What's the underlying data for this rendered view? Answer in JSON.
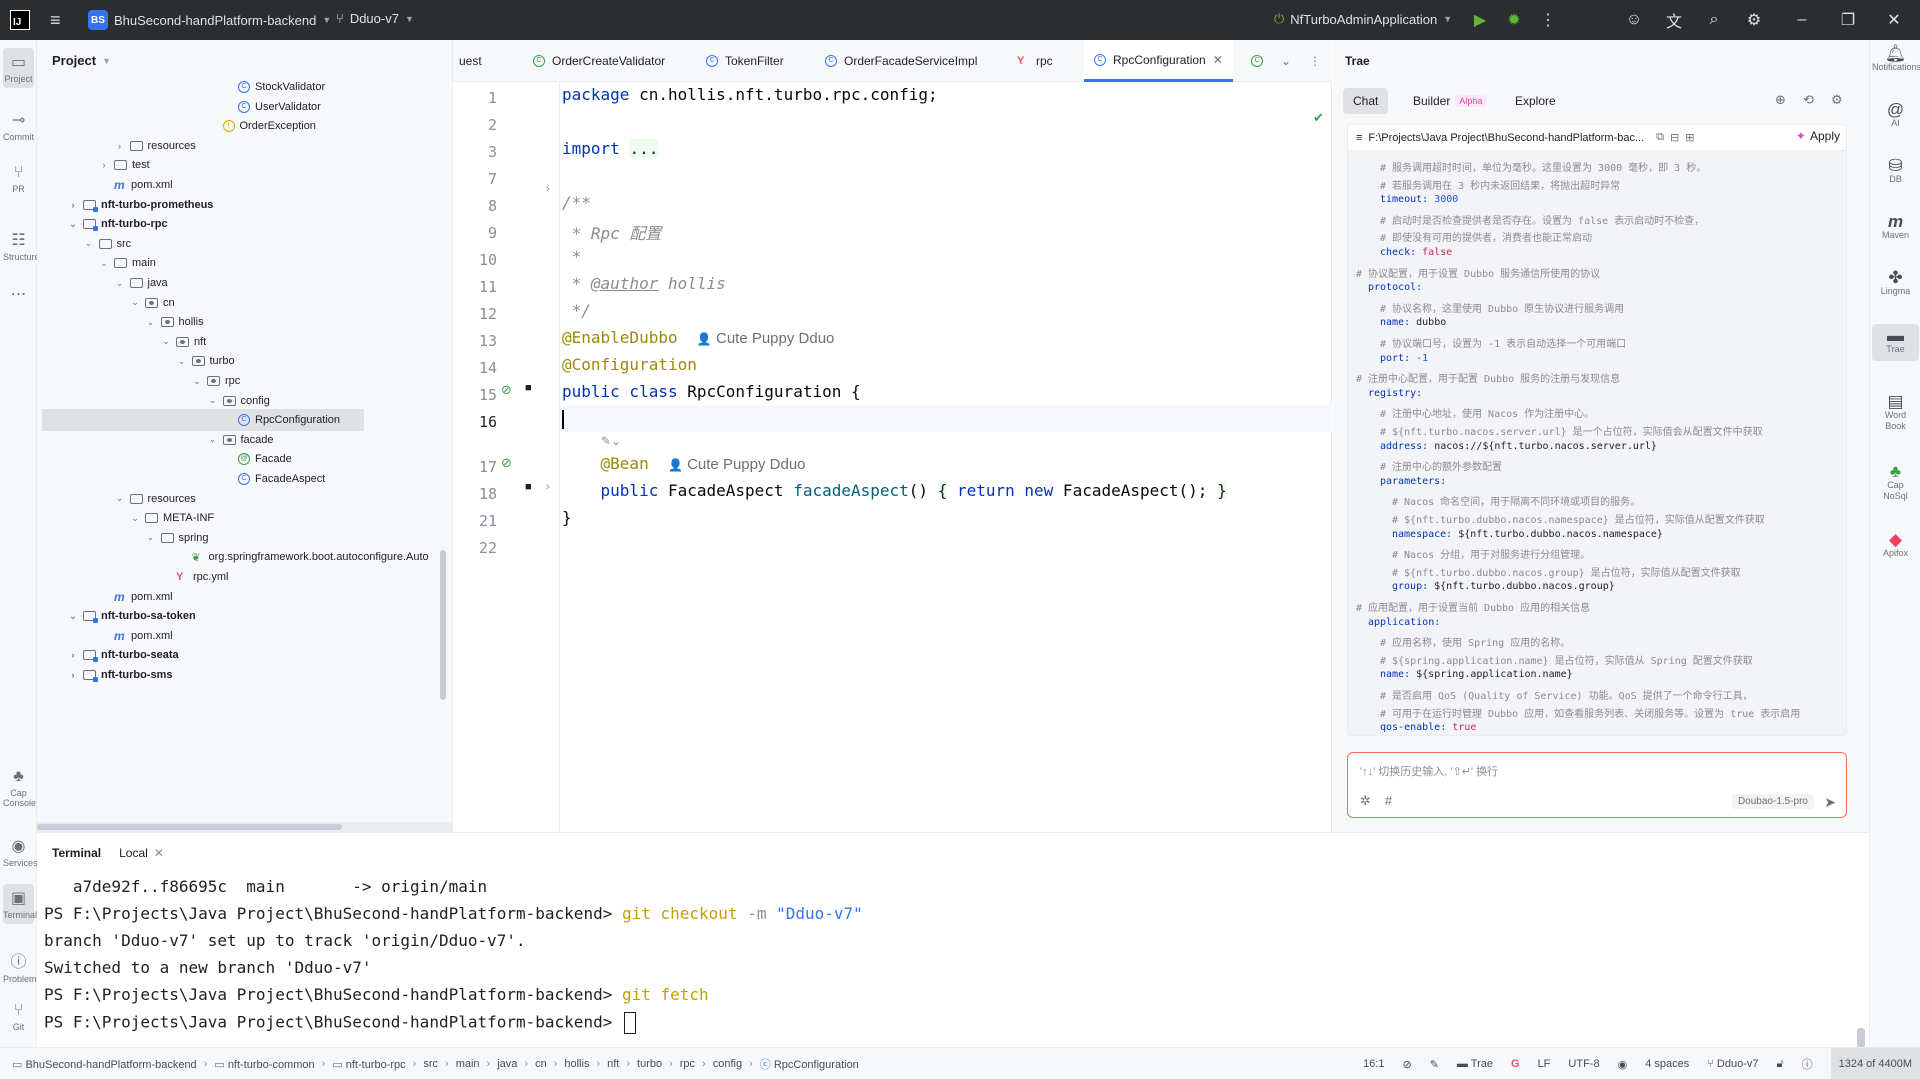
{
  "titlebar": {
    "project_badge": "BS",
    "project_name": "BhuSecond-handPlatform-backend",
    "branch": "Dduo-v7",
    "run_config": "NfTurboAdminApplication"
  },
  "left_strip": [
    {
      "label": "Project",
      "icon": "folder-icon"
    },
    {
      "label": "Commit",
      "icon": "commit-icon"
    },
    {
      "label": "PR",
      "icon": "pull-request-icon"
    },
    {
      "label": "Structure",
      "icon": "structure-icon"
    },
    {
      "label": "Cap Console",
      "icon": "cap-icon"
    },
    {
      "label": "Services",
      "icon": "services-icon"
    },
    {
      "label": "Terminal",
      "icon": "terminal-icon"
    },
    {
      "label": "Problems",
      "icon": "problems-icon"
    },
    {
      "label": "Git",
      "icon": "git-icon"
    }
  ],
  "project_panel": {
    "title": "Project",
    "rows": [
      {
        "label": "StockValidator",
        "icon": "class",
        "indent": 12,
        "arrow": "",
        "bold": false
      },
      {
        "label": "UserValidator",
        "icon": "class",
        "indent": 12,
        "arrow": "",
        "bold": false
      },
      {
        "label": "OrderException",
        "icon": "exception",
        "indent": 11,
        "arrow": "",
        "bold": false
      },
      {
        "label": "resources",
        "icon": "folder",
        "indent": 5,
        "arrow": ">",
        "bold": false
      },
      {
        "label": "test",
        "icon": "folder",
        "indent": 4,
        "arrow": ">",
        "bold": false
      },
      {
        "label": "pom.xml",
        "icon": "maven",
        "indent": 4,
        "arrow": "",
        "bold": false
      },
      {
        "label": "nft-turbo-prometheus",
        "icon": "module",
        "indent": 2,
        "arrow": ">",
        "bold": true
      },
      {
        "label": "nft-turbo-rpc",
        "icon": "module",
        "indent": 2,
        "arrow": "v",
        "bold": true
      },
      {
        "label": "src",
        "icon": "folder",
        "indent": 3,
        "arrow": "v",
        "bold": false
      },
      {
        "label": "main",
        "icon": "folder",
        "indent": 4,
        "arrow": "v",
        "bold": false
      },
      {
        "label": "java",
        "icon": "folder",
        "indent": 5,
        "arrow": "v",
        "bold": false
      },
      {
        "label": "cn",
        "icon": "package",
        "indent": 6,
        "arrow": "v",
        "bold": false
      },
      {
        "label": "hollis",
        "icon": "package",
        "indent": 7,
        "arrow": "v",
        "bold": false
      },
      {
        "label": "nft",
        "icon": "package",
        "indent": 8,
        "arrow": "v",
        "bold": false
      },
      {
        "label": "turbo",
        "icon": "package",
        "indent": 9,
        "arrow": "v",
        "bold": false
      },
      {
        "label": "rpc",
        "icon": "package",
        "indent": 10,
        "arrow": "v",
        "bold": false
      },
      {
        "label": "config",
        "icon": "package",
        "indent": 11,
        "arrow": "v",
        "bold": false
      },
      {
        "label": "RpcConfiguration",
        "icon": "class",
        "indent": 12,
        "arrow": "",
        "bold": false,
        "selected": true
      },
      {
        "label": "facade",
        "icon": "package",
        "indent": 11,
        "arrow": "v",
        "bold": false
      },
      {
        "label": "Facade",
        "icon": "annotation",
        "indent": 12,
        "arrow": "",
        "bold": false
      },
      {
        "label": "FacadeAspect",
        "icon": "class",
        "indent": 12,
        "arrow": "",
        "bold": false
      },
      {
        "label": "resources",
        "icon": "folder",
        "indent": 5,
        "arrow": "v",
        "bold": false
      },
      {
        "label": "META-INF",
        "icon": "folder",
        "indent": 6,
        "arrow": "v",
        "bold": false
      },
      {
        "label": "spring",
        "icon": "folder",
        "indent": 7,
        "arrow": "v",
        "bold": false
      },
      {
        "label": "org.springframework.boot.autoconfigure.Auto",
        "icon": "spring",
        "indent": 9,
        "arrow": "",
        "bold": false
      },
      {
        "label": "rpc.yml",
        "icon": "yml",
        "indent": 8,
        "arrow": "",
        "bold": false
      },
      {
        "label": "pom.xml",
        "icon": "maven",
        "indent": 4,
        "arrow": "",
        "bold": false
      },
      {
        "label": "nft-turbo-sa-token",
        "icon": "module",
        "indent": 2,
        "arrow": "v",
        "bold": true
      },
      {
        "label": "pom.xml",
        "icon": "maven",
        "indent": 4,
        "arrow": "",
        "bold": false
      },
      {
        "label": "nft-turbo-seata",
        "icon": "module",
        "indent": 2,
        "arrow": ">",
        "bold": true
      },
      {
        "label": "nft-turbo-sms",
        "icon": "module",
        "indent": 2,
        "arrow": ">",
        "bold": true
      }
    ]
  },
  "editor": {
    "tabs": [
      {
        "label": "uest",
        "icon": ""
      },
      {
        "label": "OrderCreateValidator",
        "icon": "green-class-icon"
      },
      {
        "label": "TokenFilter",
        "icon": "class-icon"
      },
      {
        "label": "OrderFacadeServiceImpl",
        "icon": "class-icon"
      },
      {
        "label": "rpc",
        "icon": "yml-icon"
      },
      {
        "label": "RpcConfiguration",
        "icon": "class-icon",
        "active": true
      }
    ],
    "line_numbers": [
      "1",
      "2",
      "3",
      "7",
      "8",
      "9",
      "10",
      "11",
      "12",
      "13",
      "14",
      "15",
      "16",
      "",
      "17",
      "18",
      "21",
      "22"
    ],
    "author_hint": "Cute Puppy Dduo",
    "lines": {
      "l1_kw": "package",
      "l1_rest": " cn.hollis.nft.turbo.rpc.config;",
      "l3_kw": "import",
      "l3_fold": "...",
      "l8": "/**",
      "l9": " * Rpc 配置",
      "l10": " *",
      "l11_star": " * ",
      "l11_tag": "@author",
      "l11_name": " hollis",
      "l12": " */",
      "l13": "@EnableDubbo",
      "l14": "@Configuration",
      "l15_kw": "public class",
      "l15_rest": " RpcConfiguration {",
      "l17": "@Bean",
      "l18_kw1": "public",
      "l18_type": " FacadeAspect ",
      "l18_fn": "facadeAspect",
      "l18_paren": "() ",
      "l18_ob": "{",
      "l18_ret": " return new",
      "l18_rest": " FacadeAspect(); ",
      "l18_cb": "}",
      "l21": "}"
    }
  },
  "trae": {
    "title": "Trae",
    "tabs": [
      "Chat",
      "Builder",
      "Explore"
    ],
    "builder_badge": "Alpha",
    "file_path": "F:\\Projects\\Java Project\\BhuSecond-handPlatform-bac...",
    "apply_label": "Apply",
    "yaml_lines": [
      {
        "t": "c",
        "i": 2,
        "text": "# 服务调用超时时间，单位为毫秒。这里设置为 3000 毫秒，即 3 秒。"
      },
      {
        "t": "c",
        "i": 2,
        "text": "# 若服务调用在 3 秒内未返回结果，将抛出超时异常"
      },
      {
        "t": "kv",
        "i": 2,
        "k": "timeout:",
        "v": " 3000",
        "vt": "num"
      },
      {
        "t": "c",
        "i": 2,
        "text": "# 启动时是否检查提供者是否存在。设置为 false 表示启动时不检查，"
      },
      {
        "t": "c",
        "i": 2,
        "text": "# 即使没有可用的提供者，消费者也能正常启动"
      },
      {
        "t": "kv",
        "i": 2,
        "k": "check:",
        "v": " false",
        "vt": "bool"
      },
      {
        "t": "c",
        "i": 0,
        "text": "# 协议配置，用于设置 Dubbo 服务通信所使用的协议"
      },
      {
        "t": "kv",
        "i": 1,
        "k": "protocol:",
        "v": "",
        "vt": ""
      },
      {
        "t": "c",
        "i": 2,
        "text": "# 协议名称，这里使用 Dubbo 原生协议进行服务调用"
      },
      {
        "t": "kv",
        "i": 2,
        "k": "name:",
        "v": " dubbo",
        "vt": "str"
      },
      {
        "t": "c",
        "i": 2,
        "text": "# 协议端口号，设置为 -1 表示自动选择一个可用端口"
      },
      {
        "t": "kv",
        "i": 2,
        "k": "port:",
        "v": " -1",
        "vt": "num"
      },
      {
        "t": "c",
        "i": 0,
        "text": "# 注册中心配置，用于配置 Dubbo 服务的注册与发现信息"
      },
      {
        "t": "kv",
        "i": 1,
        "k": "registry:",
        "v": "",
        "vt": ""
      },
      {
        "t": "c",
        "i": 2,
        "text": "# 注册中心地址，使用 Nacos 作为注册中心。"
      },
      {
        "t": "c",
        "i": 2,
        "text": "# ${nft.turbo.nacos.server.url} 是一个占位符，实际值会从配置文件中获取"
      },
      {
        "t": "kv",
        "i": 2,
        "k": "address:",
        "v": " nacos://${nft.turbo.nacos.server.url}",
        "vt": "str"
      },
      {
        "t": "c",
        "i": 2,
        "text": "# 注册中心的额外参数配置"
      },
      {
        "t": "kv",
        "i": 2,
        "k": "parameters:",
        "v": "",
        "vt": ""
      },
      {
        "t": "c",
        "i": 3,
        "text": "# Nacos 命名空间，用于隔离不同环境或项目的服务。"
      },
      {
        "t": "c",
        "i": 3,
        "text": "# ${nft.turbo.dubbo.nacos.namespace} 是占位符，实际值从配置文件获取"
      },
      {
        "t": "kv",
        "i": 3,
        "k": "namespace:",
        "v": " ${nft.turbo.dubbo.nacos.namespace}",
        "vt": "str"
      },
      {
        "t": "c",
        "i": 3,
        "text": "# Nacos 分组，用于对服务进行分组管理。"
      },
      {
        "t": "c",
        "i": 3,
        "text": "# ${nft.turbo.dubbo.nacos.group} 是占位符，实际值从配置文件获取"
      },
      {
        "t": "kv",
        "i": 3,
        "k": "group:",
        "v": " ${nft.turbo.dubbo.nacos.group}",
        "vt": "str"
      },
      {
        "t": "c",
        "i": 0,
        "text": "# 应用配置，用于设置当前 Dubbo 应用的相关信息"
      },
      {
        "t": "kv",
        "i": 1,
        "k": "application:",
        "v": "",
        "vt": ""
      },
      {
        "t": "c",
        "i": 2,
        "text": "# 应用名称，使用 Spring 应用的名称。"
      },
      {
        "t": "c",
        "i": 2,
        "text": "# ${spring.application.name} 是占位符，实际值从 Spring 配置文件获取"
      },
      {
        "t": "kv",
        "i": 2,
        "k": "name:",
        "v": " ${spring.application.name}",
        "vt": "str"
      },
      {
        "t": "c",
        "i": 2,
        "text": "# 是否启用 QoS (Quality of Service) 功能。QoS 提供了一个命令行工具，"
      },
      {
        "t": "c",
        "i": 2,
        "text": "# 可用于在运行时管理 Dubbo 应用，如查看服务列表、关闭服务等。设置为 true 表示启用"
      },
      {
        "t": "kv",
        "i": 2,
        "k": "qos-enable:",
        "v": " true",
        "vt": "bool"
      }
    ],
    "input_placeholder": "'↑↓' 切换历史输入, '⇧↵' 换行",
    "model": "Doubao-1.5-pro"
  },
  "right_strip": [
    {
      "label": "Notifications",
      "icon": "bell-icon"
    },
    {
      "label": "AI",
      "icon": "ai-icon"
    },
    {
      "label": "DB",
      "icon": "database-icon"
    },
    {
      "label": "Maven",
      "icon": "maven-icon"
    },
    {
      "label": "Lingma",
      "icon": "lingma-icon"
    },
    {
      "label": "Trae",
      "icon": "trae-icon"
    },
    {
      "label": "Word Book",
      "icon": "word-book-icon"
    },
    {
      "label": "Cap NoSql",
      "icon": "cap-nosql-icon"
    },
    {
      "label": "Apifox",
      "icon": "apifox-icon"
    }
  ],
  "terminal": {
    "tab_title": "Terminal",
    "tab_local": "Local",
    "lines": [
      {
        "plain": "   a7de92f..f86695c  main       -> origin/main"
      },
      {
        "prompt": "PS F:\\Projects\\Java Project\\BhuSecond-handPlatform-backend> ",
        "cmd": "git checkout",
        "arg": " -m ",
        "str": "\"Dduo-v7\""
      },
      {
        "plain": "branch 'Dduo-v7' set up to track 'origin/Dduo-v7'."
      },
      {
        "plain": "Switched to a new branch 'Dduo-v7'"
      },
      {
        "prompt": "PS F:\\Projects\\Java Project\\BhuSecond-handPlatform-backend> ",
        "cmd": "git fetch",
        "arg": "",
        "str": ""
      },
      {
        "prompt": "PS F:\\Projects\\Java Project\\BhuSecond-handPlatform-backend> ",
        "cmd": "",
        "arg": "",
        "str": "",
        "cursor": true
      }
    ]
  },
  "statusbar": {
    "breadcrumbs": [
      "BhuSecond-handPlatform-backend",
      "nft-turbo-common",
      "nft-turbo-rpc",
      "src",
      "main",
      "java",
      "cn",
      "hollis",
      "nft",
      "turbo",
      "rpc",
      "config",
      "RpcConfiguration"
    ],
    "position": "16:1",
    "trae": "Trae",
    "line_sep": "LF",
    "encoding": "UTF-8",
    "indent": "4 spaces",
    "branch": "Dduo-v7",
    "memory": "1324 of 4400M"
  }
}
